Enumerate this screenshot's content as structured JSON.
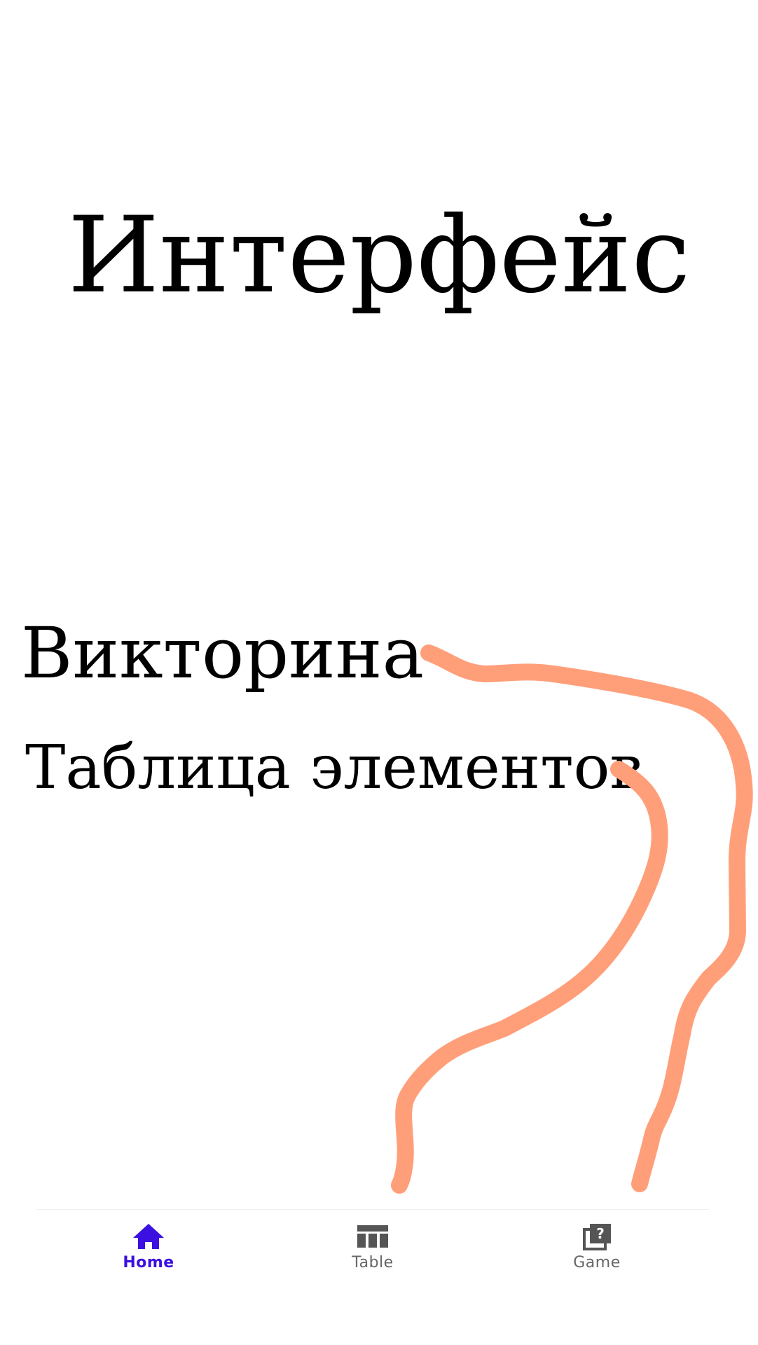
{
  "title": "Интерфейс",
  "menu": {
    "quiz_label": "Викторина",
    "table_label": "Таблица элементов"
  },
  "bottom_nav": {
    "items": [
      {
        "label": "Home",
        "icon": "home-icon",
        "active": true
      },
      {
        "label": "Table",
        "icon": "table-icon",
        "active": false
      },
      {
        "label": "Game",
        "icon": "quiz-game-icon",
        "active": false
      }
    ]
  },
  "colors": {
    "accent": "#3b10e0",
    "inactive": "#666666",
    "annotation_stroke": "#ff9f7a",
    "text": "#000000"
  }
}
